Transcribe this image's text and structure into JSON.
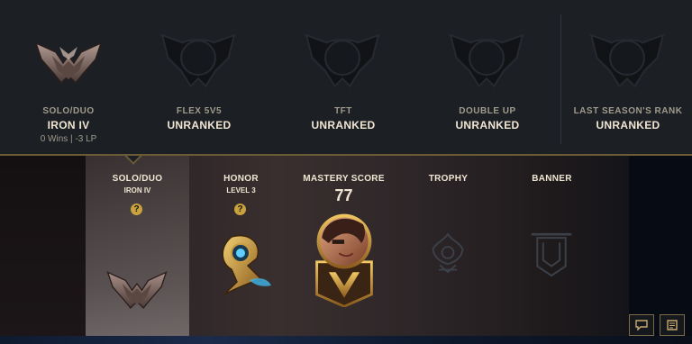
{
  "ranks": [
    {
      "queue": "SOLO/DUO",
      "tier": "IRON IV",
      "detail": "0 Wins | -3 LP",
      "ranked": true
    },
    {
      "queue": "FLEX 5V5",
      "tier": "UNRANKED",
      "detail": "",
      "ranked": false
    },
    {
      "queue": "TFT",
      "tier": "UNRANKED",
      "detail": "",
      "ranked": false
    },
    {
      "queue": "DOUBLE UP",
      "tier": "UNRANKED",
      "detail": "",
      "ranked": false
    },
    {
      "queue": "LAST SEASON'S RANK",
      "tier": "UNRANKED",
      "detail": "",
      "ranked": false
    }
  ],
  "showcase": {
    "solo": {
      "title": "SOLO/DUO",
      "sub": "IRON IV",
      "help": "?"
    },
    "honor": {
      "title": "HONOR",
      "sub": "LEVEL 3",
      "help": "?"
    },
    "mastery": {
      "title": "MASTERY SCORE",
      "score": "77"
    },
    "trophy": {
      "title": "TROPHY"
    },
    "banner": {
      "title": "BANNER"
    }
  },
  "colors": {
    "gold": "#c8aa6e",
    "panel": "#1c1f24",
    "text": "#f0e6d2"
  },
  "icons": {
    "chat": "chat-icon",
    "notes": "notes-icon"
  }
}
